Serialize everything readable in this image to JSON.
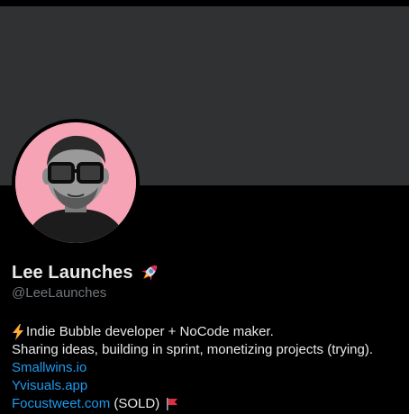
{
  "profile": {
    "display_name": "Lee Launches",
    "name_emoji": "rocket-icon",
    "handle": "@LeeLaunches",
    "avatar_alt": "Profile photo of a man wearing thick black glasses on a pink background"
  },
  "bio": {
    "line1_icon": "lightning-bolt-icon",
    "line1": "Indie Bubble developer + NoCode maker.",
    "line2": "Sharing ideas, building in sprint, monetizing projects (trying).",
    "link1": "Smallwins.io",
    "link2": "Yvisuals.app",
    "link3": "Focustweet.com",
    "link3_suffix": "(SOLD)",
    "link3_icon": "red-flag-icon"
  },
  "colors": {
    "background": "#000000",
    "banner": "#2f3133",
    "avatar_bg": "#f5a3b5",
    "text": "#e7e9ea",
    "muted": "#71767b",
    "link": "#1d9bf0"
  }
}
